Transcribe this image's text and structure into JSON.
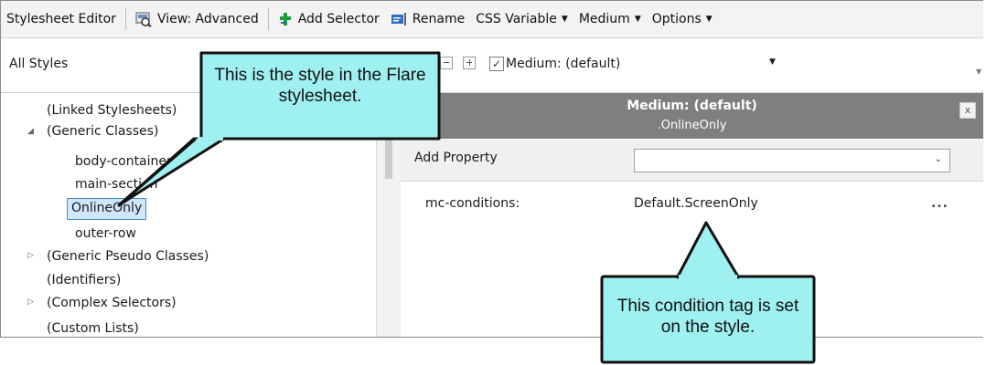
{
  "toolbar": {
    "title": "Stylesheet Editor",
    "view_label": "View: Advanced",
    "add_selector_label": "Add Selector",
    "rename_label": "Rename",
    "css_variable_label": "CSS Variable",
    "medium_label": "Medium",
    "options_label": "Options"
  },
  "filter": {
    "styles_label": "All Styles",
    "medium_checked": true,
    "medium_value": "Medium: (default)"
  },
  "tree": {
    "items": [
      {
        "label": "(Linked Stylesheets)"
      },
      {
        "label": "(Generic Classes)"
      },
      {
        "label": "body-container"
      },
      {
        "label": "main-section"
      },
      {
        "label": "OnlineOnly",
        "selected": true
      },
      {
        "label": "outer-row"
      },
      {
        "label": "(Generic Pseudo Classes)"
      },
      {
        "label": "(Identifiers)"
      },
      {
        "label": "(Complex Selectors)"
      },
      {
        "label": "(Custom Lists)"
      }
    ]
  },
  "properties": {
    "header_title": "Medium: (default)",
    "header_subtitle": ".OnlineOnly",
    "close_label": "x",
    "add_property_label": "Add Property",
    "add_property_value": "",
    "rows": [
      {
        "name": "mc-conditions:",
        "value": "Default.ScreenOnly",
        "action": "..."
      }
    ]
  },
  "callouts": {
    "style_note": "This is the style in the Flare stylesheet.",
    "condition_note": "This condition tag is set on the style."
  },
  "colors": {
    "callout_fill": "#9ff0f0",
    "header_gray": "#7f7f7f",
    "selection_bg": "#cfe6fb"
  }
}
